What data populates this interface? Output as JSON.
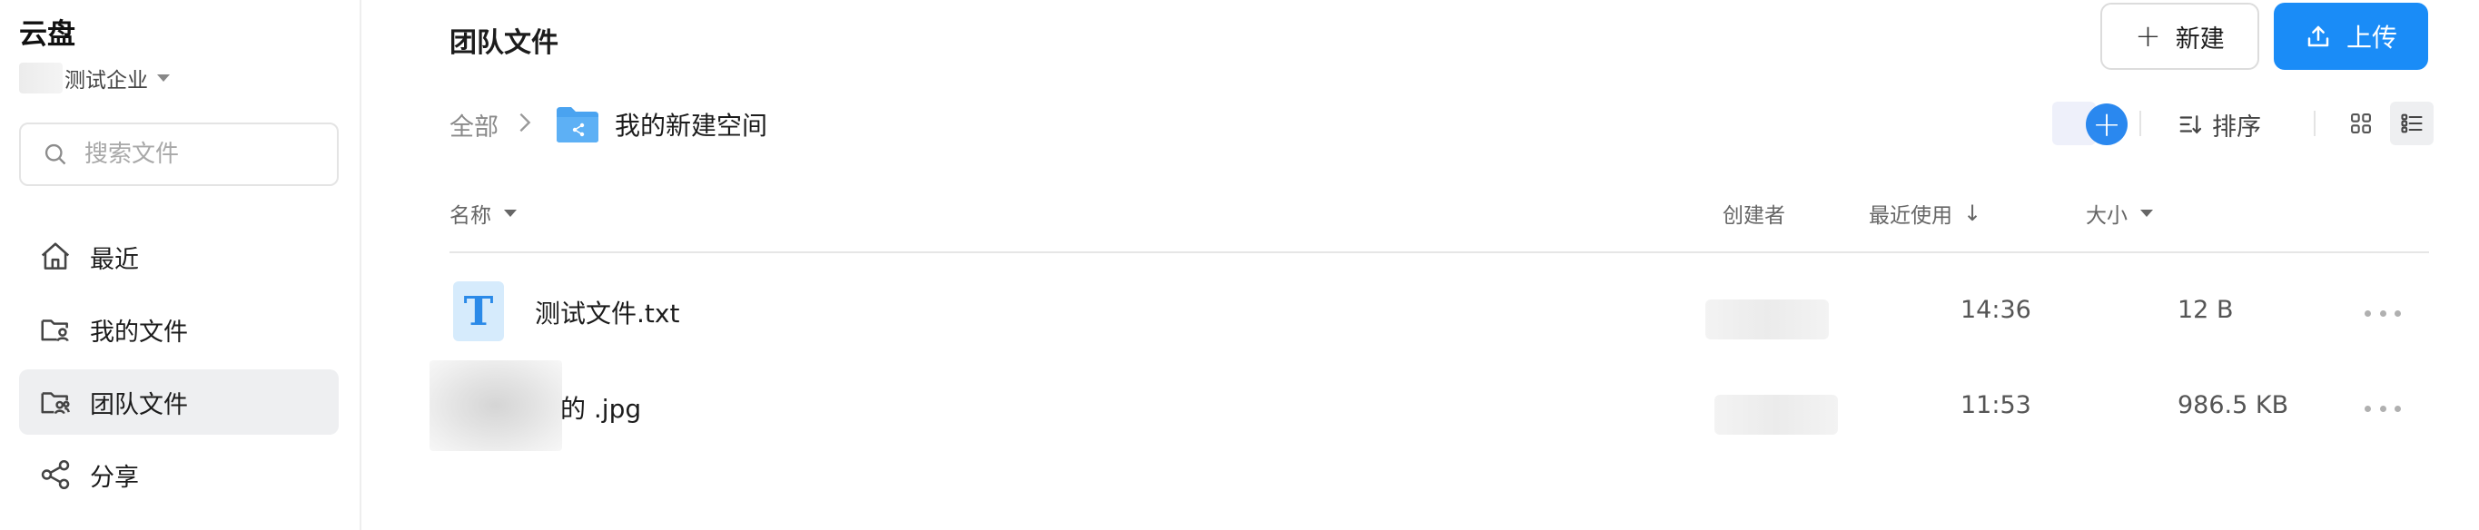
{
  "sidebar": {
    "app_title": "云盘",
    "org_name": "测试企业",
    "search_placeholder": "搜索文件",
    "items": [
      {
        "label": "最近",
        "icon": "home-icon"
      },
      {
        "label": "我的文件",
        "icon": "user-folder-icon"
      },
      {
        "label": "团队文件",
        "icon": "team-folder-icon",
        "active": true
      },
      {
        "label": "分享",
        "icon": "share-icon"
      }
    ]
  },
  "header": {
    "title": "团队文件",
    "new_label": "新建",
    "upload_label": "上传"
  },
  "breadcrumb": {
    "root": "全部",
    "current": "我的新建空间"
  },
  "toolbar": {
    "sort_label": "排序"
  },
  "table": {
    "columns": {
      "name": "名称",
      "creator": "创建者",
      "recent": "最近使用",
      "size": "大小"
    },
    "rows": [
      {
        "name": "测试文件.txt",
        "time": "14:36",
        "size": "12 B",
        "type": "txt"
      },
      {
        "name": "的 .jpg",
        "time": "11:53",
        "size": "986.5 KB",
        "type": "jpg"
      }
    ]
  },
  "colors": {
    "accent": "#1a8cf7",
    "active_bg": "#eeeff1",
    "folder": "#4aa3f0"
  }
}
